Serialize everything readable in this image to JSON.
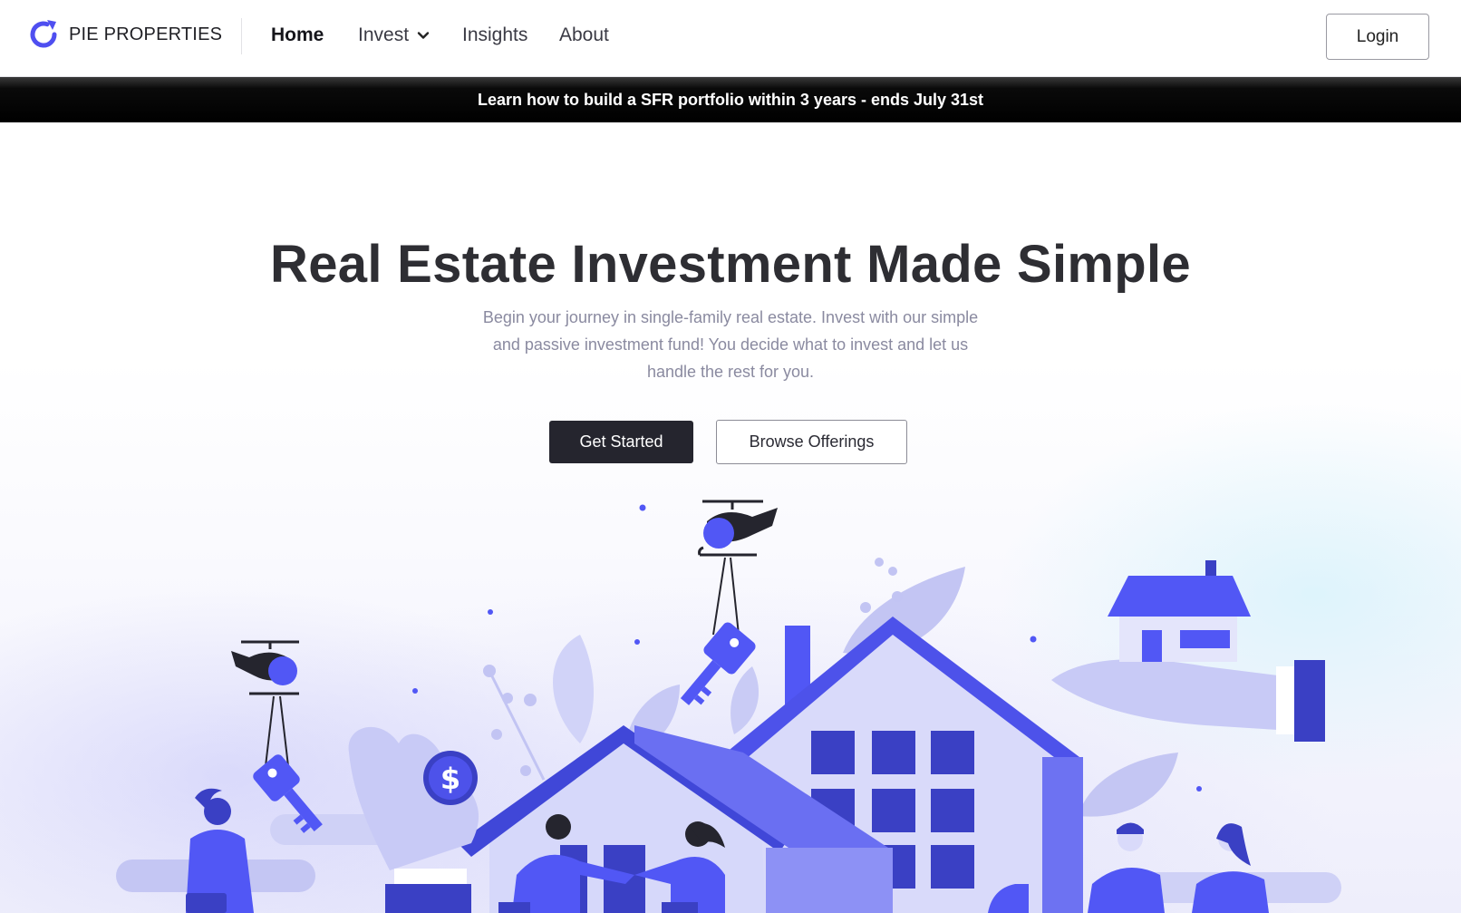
{
  "brand": {
    "name": "PIE PROPERTIES",
    "accent": "#4f4ff0"
  },
  "nav": {
    "items": [
      {
        "label": "Home",
        "active": true
      },
      {
        "label": "Invest",
        "has_dropdown": true
      },
      {
        "label": "Insights"
      },
      {
        "label": "About"
      }
    ],
    "login_label": "Login"
  },
  "banner": {
    "text": "Learn how to build a SFR portfolio within 3 years - ends July 31st"
  },
  "hero": {
    "title": "Real Estate Investment Made Simple",
    "subtitle": "Begin your journey in single-family real estate. Invest with our simple and passive investment fund! You decide what to invest and let us handle the rest for you.",
    "primary_cta": "Get Started",
    "secondary_cta": "Browse Offerings"
  },
  "colors": {
    "illustration_primary": "#5157f5",
    "illustration_dark": "#3a40c4",
    "illustration_light": "#c9cbf7",
    "illustration_pale": "#e4e5fb",
    "banner_bg": "#000000",
    "cta_dark": "#25252e"
  }
}
